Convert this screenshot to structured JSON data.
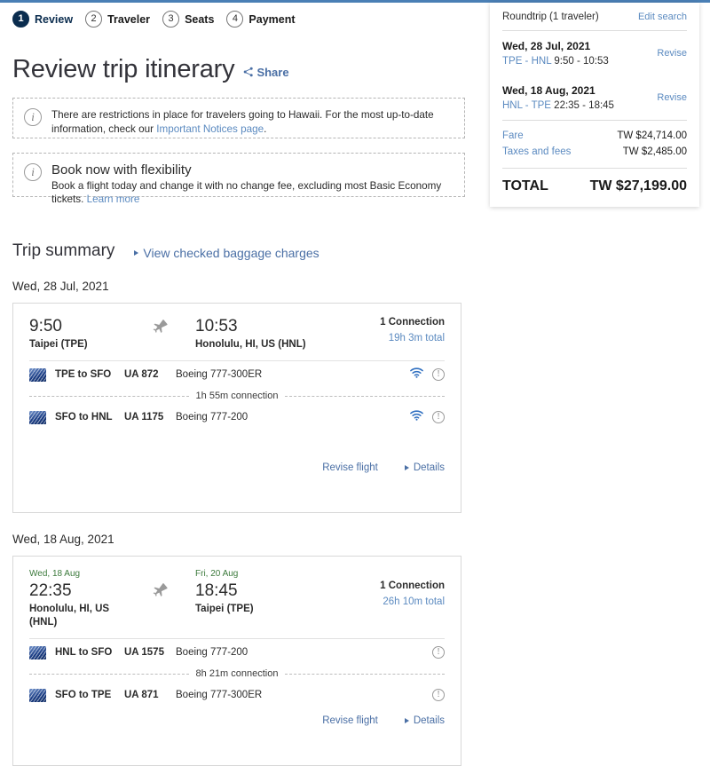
{
  "steps": [
    {
      "num": "1",
      "label": "Review",
      "active": true
    },
    {
      "num": "2",
      "label": "Traveler",
      "active": false
    },
    {
      "num": "3",
      "label": "Seats",
      "active": false
    },
    {
      "num": "4",
      "label": "Payment",
      "active": false
    }
  ],
  "page": {
    "title": "Review trip itinerary",
    "share_label": "Share"
  },
  "notices": {
    "restrictions": {
      "text_before": "There are restrictions in place for travelers going to Hawaii. For the most up-to-date information, check our ",
      "link": "Important Notices page",
      "text_after": "."
    },
    "flexibility": {
      "title": "Book now with flexibility",
      "text": "Book a flight today and change it with no change fee, excluding most Basic Economy tickets. ",
      "link": "Learn more"
    }
  },
  "trip_summary": {
    "title": "Trip summary",
    "baggage_link": "View checked baggage charges"
  },
  "itinerary": [
    {
      "date_heading": "Wed, 28 Jul, 2021",
      "depart": {
        "date": "",
        "time": "9:50",
        "place": "Taipei (TPE)"
      },
      "arrive": {
        "date": "",
        "time": "10:53",
        "place": "Honolulu, HI, US (HNL)"
      },
      "connections_label": "1 Connection",
      "duration_label": "19h 3m total",
      "legs": [
        {
          "route": "TPE to SFO",
          "flight_no": "UA 872",
          "aircraft": "Boeing 777-300ER",
          "wifi": true,
          "info": true
        },
        {
          "route": "SFO to HNL",
          "flight_no": "UA 1175",
          "aircraft": "Boeing 777-200",
          "wifi": true,
          "info": true
        }
      ],
      "connection_text": "1h 55m connection",
      "revise_label": "Revise flight",
      "details_label": "Details"
    },
    {
      "date_heading": "Wed, 18 Aug, 2021",
      "depart": {
        "date": "Wed, 18 Aug",
        "time": "22:35",
        "place": "Honolulu, HI, US (HNL)"
      },
      "arrive": {
        "date": "Fri, 20 Aug",
        "time": "18:45",
        "place": "Taipei (TPE)"
      },
      "connections_label": "1 Connection",
      "duration_label": "26h 10m total",
      "legs": [
        {
          "route": "HNL to SFO",
          "flight_no": "UA 1575",
          "aircraft": "Boeing 777-200",
          "wifi": false,
          "info": true
        },
        {
          "route": "SFO to TPE",
          "flight_no": "UA 871",
          "aircraft": "Boeing 777-300ER",
          "wifi": false,
          "info": true
        }
      ],
      "connection_text": "8h 21m connection",
      "revise_label": "Revise flight",
      "details_label": "Details"
    }
  ],
  "summary_panel": {
    "trip_type": "Roundtrip (1 traveler)",
    "edit_search": "Edit search",
    "legs": [
      {
        "date": "Wed, 28 Jul, 2021",
        "route": "TPE - HNL",
        "times": "9:50 - 10:53",
        "revise": "Revise"
      },
      {
        "date": "Wed, 18 Aug, 2021",
        "route": "HNL - TPE",
        "times": "22:35 - 18:45",
        "revise": "Revise"
      }
    ],
    "fare_rows": [
      {
        "label": "Fare",
        "value": "TW $24,714.00"
      },
      {
        "label": "Taxes and fees",
        "value": "TW $2,485.00"
      }
    ],
    "total_label": "TOTAL",
    "total_value": "TW $27,199.00"
  },
  "colors": {
    "accent_blue": "#4a7fb5",
    "link_blue": "#5b8ac0",
    "active_step": "#0a2c4e",
    "green_date": "#3c7a3c"
  }
}
